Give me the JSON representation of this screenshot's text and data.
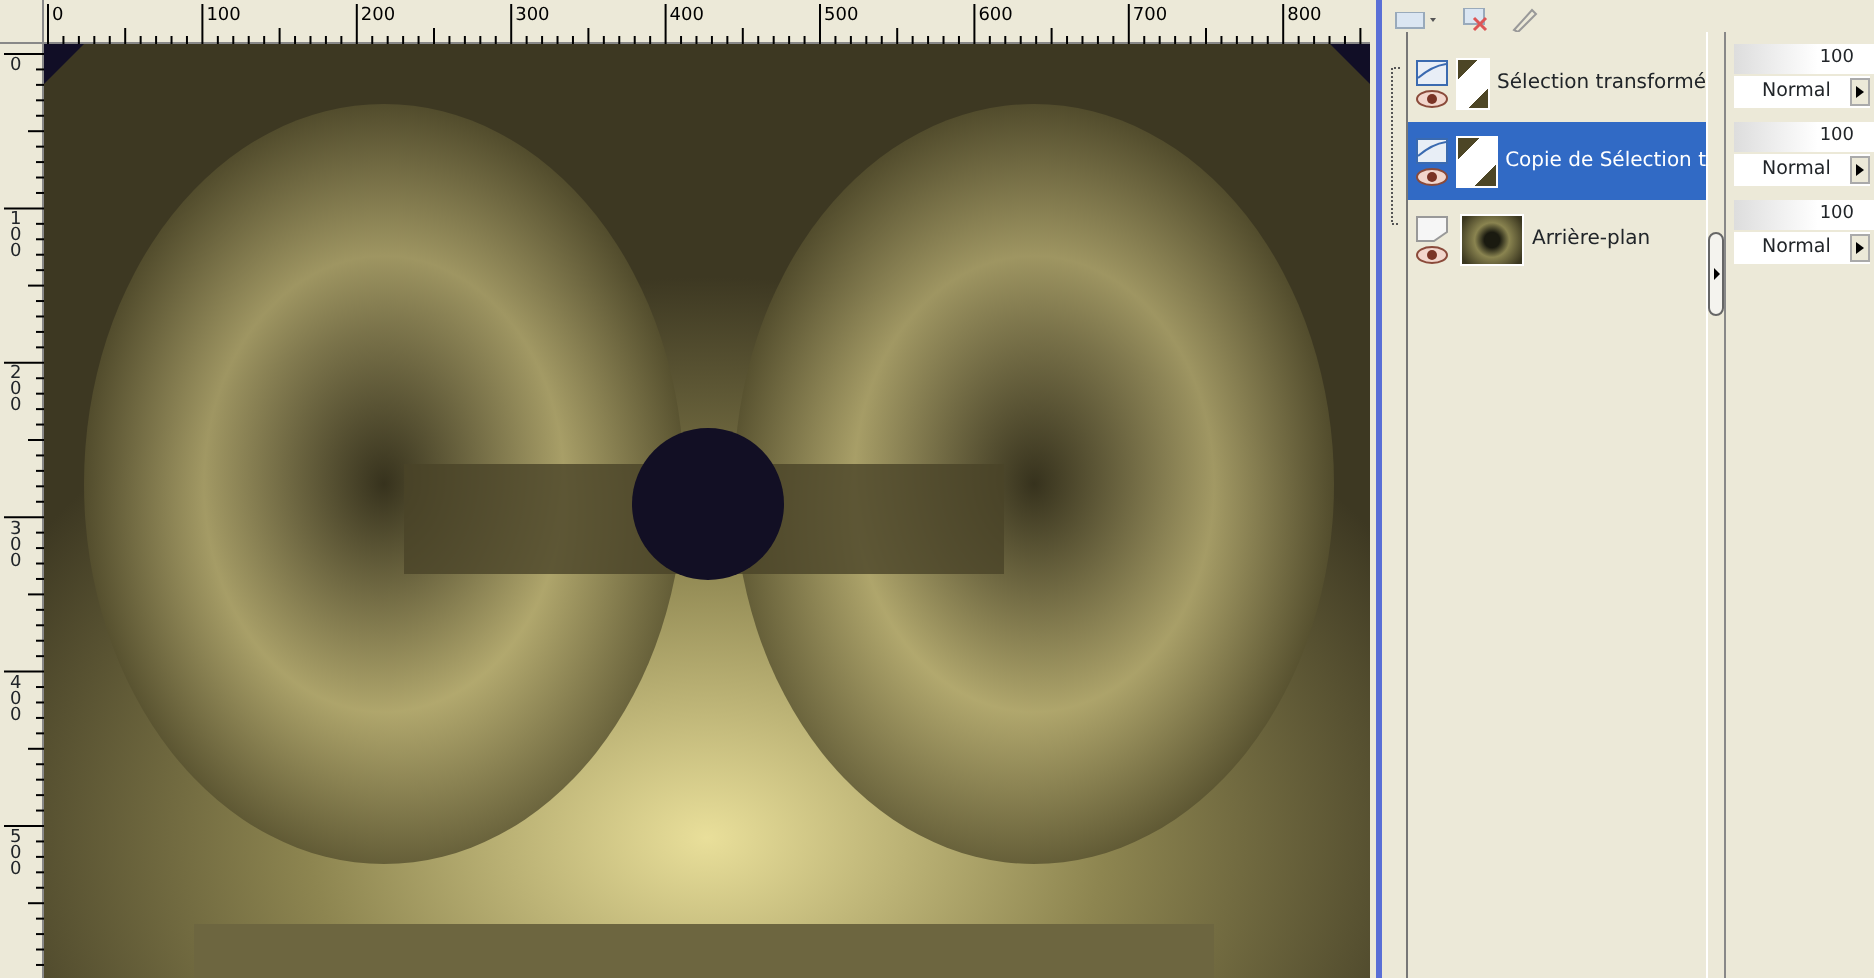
{
  "rulers": {
    "horizontal": [
      "0",
      "100",
      "200",
      "300",
      "400",
      "500",
      "600",
      "700",
      "800"
    ],
    "vertical": [
      "0",
      "100",
      "200",
      "300",
      "400",
      "500"
    ]
  },
  "layers": [
    {
      "name": "Sélection transformé",
      "kind": "raster",
      "selected": false,
      "visible": true,
      "opacity": "100",
      "blend_mode": "Normal"
    },
    {
      "name": "Copie de Sélection t",
      "kind": "raster",
      "selected": true,
      "visible": true,
      "opacity": "100",
      "blend_mode": "Normal"
    },
    {
      "name": "Arrière-plan",
      "kind": "background",
      "selected": false,
      "visible": true,
      "opacity": "100",
      "blend_mode": "Normal"
    }
  ]
}
